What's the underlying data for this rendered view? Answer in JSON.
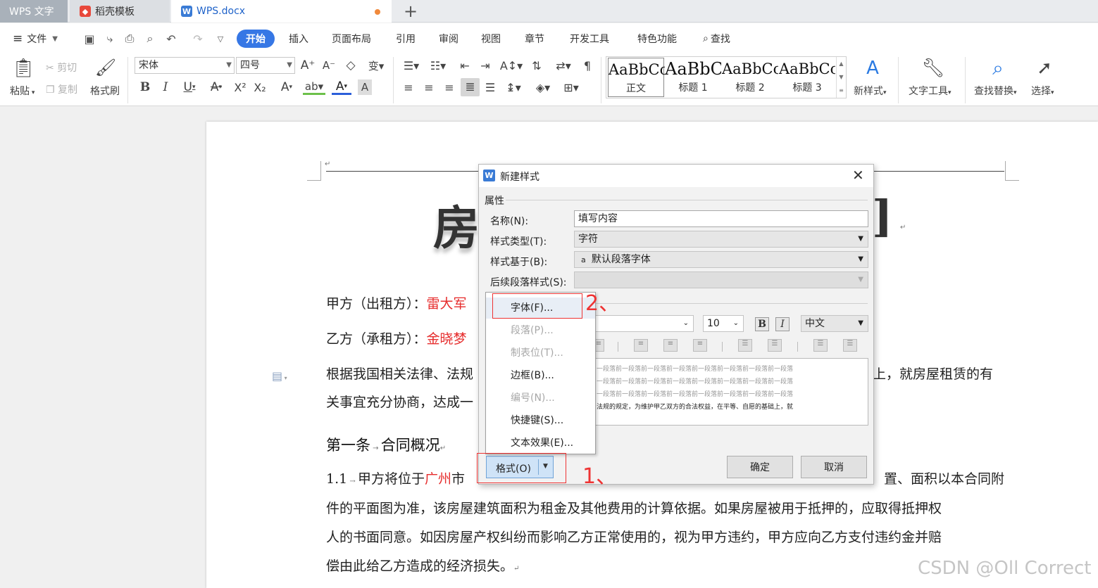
{
  "tabs": {
    "wps": "WPS 文字",
    "daoke": "稻壳模板",
    "doc": "WPS.docx",
    "plus": "+"
  },
  "menu": {
    "file": "文件",
    "items": [
      "开始",
      "插入",
      "页面布局",
      "引用",
      "审阅",
      "视图",
      "章节",
      "开发工具",
      "特色功能",
      "查找"
    ]
  },
  "ribbon": {
    "paste": "粘贴",
    "cut": "剪切",
    "copy": "复制",
    "format_painter": "格式刷",
    "font_name": "宋体",
    "font_size": "四号",
    "styles": [
      {
        "preview": "AaBbCcI",
        "name": "正文"
      },
      {
        "preview": "AaBbC",
        "name": "标题 1"
      },
      {
        "preview": "AaBbCc",
        "name": "标题 2"
      },
      {
        "preview": "AaBbCc",
        "name": "标题 3"
      }
    ],
    "new_style": "新样式",
    "text_tools": "文字工具",
    "find_replace": "查找替换",
    "select": "选择"
  },
  "document": {
    "title_left": "房",
    "title_right": "]",
    "party_a_label": "甲方（出租方）：",
    "party_a_name": "雷大军",
    "party_b_label": "乙方（承租方）：",
    "party_b_name": "金晓梦",
    "para1_a": "根据我国相关法律、法规",
    "para1_b": "上，就房屋租赁的有",
    "para1_c": "关事宜充分协商，达成一",
    "section1_num": "第一条",
    "section1_title": "合同概况",
    "clause_num": "1.1",
    "clause_a": "甲方将位于",
    "clause_city": "广州",
    "clause_b": "市",
    "clause_c": "置、面积以本合同附",
    "line2": "件的平面图为准，该房屋建筑面积为租金及其他费用的计算依据。如果房屋被用于抵押的，应取得抵押权",
    "line3": "人的书面同意。如因房屋产权纠纷而影响乙方正常使用的，视为甲方违约，甲方应向乙方支付违约金并赔",
    "line4": "偿由此给乙方造成的经济损失。"
  },
  "dialog": {
    "title": "新建样式",
    "section_properties": "属性",
    "name_label": "名称(N):",
    "name_value": "填写内容",
    "type_label": "样式类型(T):",
    "type_value": "字符",
    "based_label": "样式基于(B):",
    "based_value": "默认段落字体",
    "next_label": "后续段落样式(S):",
    "next_value": "",
    "font_size": "10",
    "lang": "中文",
    "bold": "B",
    "italic": "I",
    "preview_lines": [
      "一段落前一段落前一段落前一段落前一段落前一段落前一段落前一段落",
      "一段落前一段落前一段落前一段落前一段落前一段落前一段落前一段落",
      "一段落前一段落前一段落前一段落前一段落前一段落前一段落前一段落",
      "法规的规定，为维护甲乙双方的合法权益，在平等、自愿的基础上，就"
    ],
    "format_button": "格式(O)",
    "ok": "确定",
    "cancel": "取消"
  },
  "format_menu": {
    "items": [
      {
        "label": "字体(F)...",
        "enabled": true
      },
      {
        "label": "段落(P)...",
        "enabled": false
      },
      {
        "label": "制表位(T)...",
        "enabled": false
      },
      {
        "label": "边框(B)...",
        "enabled": true
      },
      {
        "label": "编号(N)...",
        "enabled": false
      },
      {
        "label": "快捷键(S)...",
        "enabled": true
      },
      {
        "label": "文本效果(E)...",
        "enabled": true
      }
    ]
  },
  "annotations": {
    "step1": "1、",
    "step2": "2、"
  },
  "watermark": "CSDN @Oll Correct",
  "colors": {
    "accent": "#3677e5",
    "annotation": "#e33333",
    "highlight_text": "#e62d2d"
  }
}
